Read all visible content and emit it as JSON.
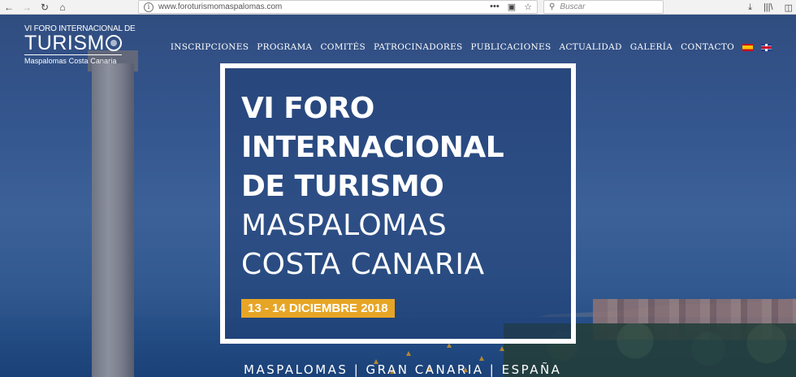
{
  "browser": {
    "url": "www.foroturismomaspalomas.com",
    "search_placeholder": "Buscar",
    "page_actions": "•••"
  },
  "logo": {
    "line1": "VI FORO INTERNACIONAL DE",
    "line2": "TURISM",
    "line3": "Maspalomas Costa Canaria"
  },
  "nav": {
    "items": [
      {
        "label": "INSCRIPCIONES"
      },
      {
        "label": "PROGRAMA"
      },
      {
        "label": "COMITÉS"
      },
      {
        "label": "PATROCINADORES"
      },
      {
        "label": "PUBLICACIONES"
      },
      {
        "label": "ACTUALIDAD"
      },
      {
        "label": "GALERÍA"
      },
      {
        "label": "CONTACTO"
      }
    ]
  },
  "hero": {
    "title_line1": "VI FORO",
    "title_line2": "INTERNACIONAL",
    "title_line3": "DE TURISMO",
    "subtitle_line1": "MASPALOMAS",
    "subtitle_line2": "COSTA CANARIA",
    "date": "13 - 14 DICIEMBRE 2018",
    "location": "MASPALOMAS | GRAN CANARIA | ESPAÑA"
  },
  "colors": {
    "accent": "#e7a526",
    "overlay": "#1c3a6e"
  }
}
